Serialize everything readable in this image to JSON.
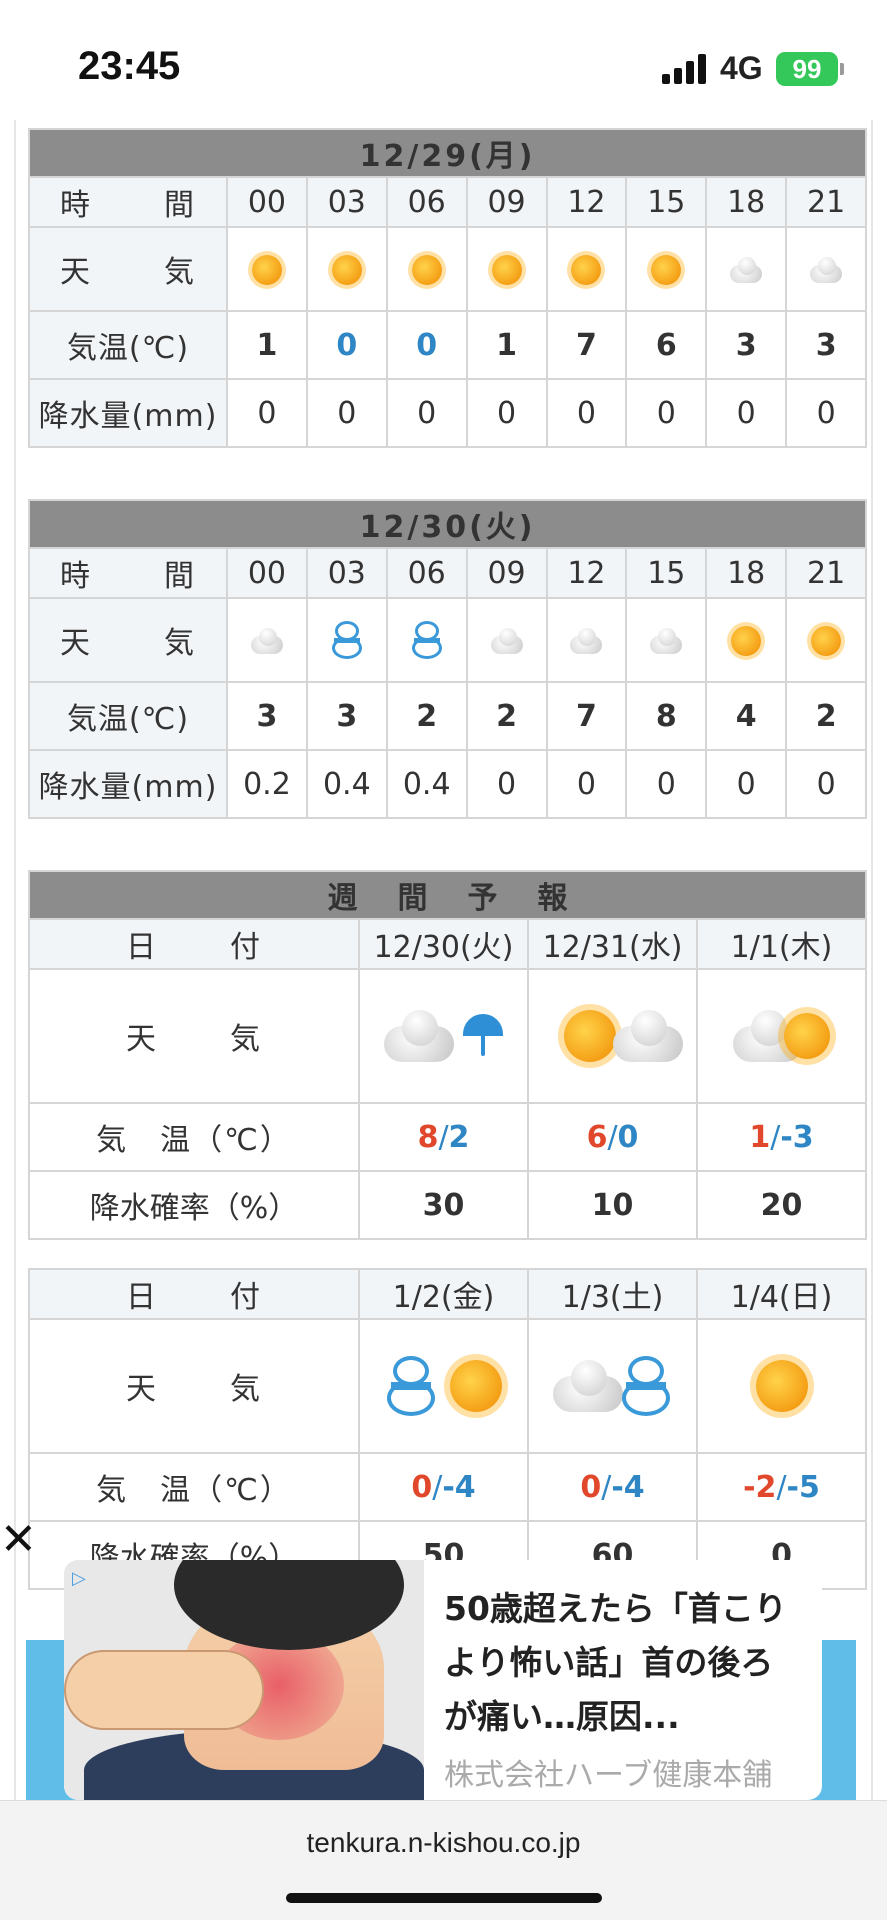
{
  "status": {
    "time": "23:45",
    "network": "4G",
    "battery": "99"
  },
  "hourly": [
    {
      "date": "12/29(月)",
      "time_label": "時　間",
      "weather_label": "天　気",
      "temp_label": "気温(℃)",
      "precip_label": "降水量(mm)",
      "hours": [
        "00",
        "03",
        "06",
        "09",
        "12",
        "15",
        "18",
        "21"
      ],
      "weather": [
        "sun-icon",
        "sun-icon",
        "sun-icon",
        "sun-icon",
        "sun-icon",
        "sun-icon",
        "cloud-icon",
        "cloud-icon"
      ],
      "temps": [
        "1",
        "0",
        "0",
        "1",
        "7",
        "6",
        "3",
        "3"
      ],
      "precip": [
        "0",
        "0",
        "0",
        "0",
        "0",
        "0",
        "0",
        "0"
      ]
    },
    {
      "date": "12/30(火)",
      "time_label": "時　間",
      "weather_label": "天　気",
      "temp_label": "気温(℃)",
      "precip_label": "降水量(mm)",
      "hours": [
        "00",
        "03",
        "06",
        "09",
        "12",
        "15",
        "18",
        "21"
      ],
      "weather": [
        "cloud-icon",
        "snowman-icon",
        "snowman-icon",
        "cloud-icon",
        "cloud-icon",
        "cloud-icon",
        "sun-icon",
        "sun-icon"
      ],
      "temps": [
        "3",
        "3",
        "2",
        "2",
        "7",
        "8",
        "4",
        "2"
      ],
      "precip": [
        "0.2",
        "0.4",
        "0.4",
        "0",
        "0",
        "0",
        "0",
        "0"
      ]
    }
  ],
  "weekly": {
    "title": "週間予報",
    "date_label": "日　付",
    "weather_label": "天　気",
    "temp_label": "気　温（℃）",
    "rain_label": "降水確率（%）",
    "rows": [
      {
        "days": [
          {
            "date": "12/30(火)",
            "icon": "cloud-umbrella-icon",
            "high": "8",
            "low": "2",
            "rain": "30"
          },
          {
            "date": "12/31(水)",
            "icon": "sun-cloud-icon",
            "high": "6",
            "low": "0",
            "rain": "10"
          },
          {
            "date": "1/1(木)",
            "icon": "cloud-sun-icon",
            "high": "1",
            "low": "-3",
            "rain": "20"
          }
        ]
      },
      {
        "days": [
          {
            "date": "1/2(金)",
            "icon": "snow-then-sun-icon",
            "high": "0",
            "low": "-4",
            "rain": "50"
          },
          {
            "date": "1/3(土)",
            "icon": "cloud-then-snow-icon",
            "high": "0",
            "low": "-4",
            "rain": "60"
          },
          {
            "date": "1/4(日)",
            "icon": "sun-icon",
            "high": "-2",
            "low": "-5",
            "rain": "0"
          }
        ]
      }
    ]
  },
  "ad": {
    "title": "50歳超えたら「首こりより怖い話」首の後ろが痛い…原因...",
    "sponsor": "株式会社ハーブ健康本舗",
    "close": "✕"
  },
  "browser": {
    "url": "tenkura.n-kishou.co.jp"
  },
  "colors": {
    "header_gray": "#8c8c8c",
    "temp_blue": "#2f86c4",
    "temp_red": "#e0472b",
    "rain_navy": "#1f2b7a"
  }
}
